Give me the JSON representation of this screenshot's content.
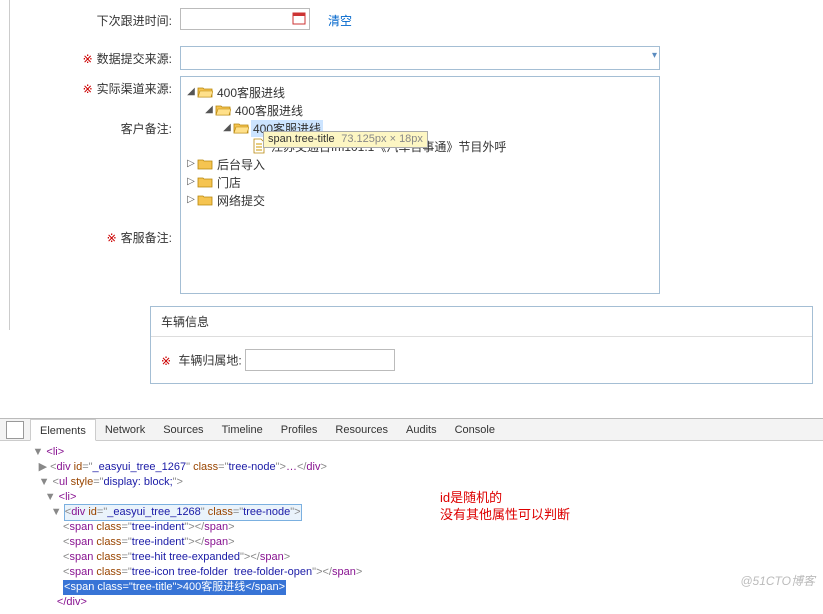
{
  "form": {
    "next_follow_label": "下次跟进时间:",
    "next_follow_value": "",
    "clear_link": "清空",
    "data_source_label": "数据提交来源:",
    "channel_label": "实际渠道来源:",
    "cust_remark_label": "客户备注:",
    "cs_remark_label": "客服备注:"
  },
  "tree": {
    "nodes": [
      {
        "label": "400客服进线",
        "level": 0,
        "expand": "open",
        "icon": "folder-open"
      },
      {
        "label": "400客服进线",
        "level": 1,
        "expand": "open",
        "icon": "folder-open"
      },
      {
        "label": "400客服进线",
        "level": 2,
        "expand": "open",
        "icon": "folder-open",
        "selected": true
      },
      {
        "label": "江苏交通台fm101.1《汽车百事通》节目外呼",
        "level": 3,
        "expand": "none",
        "icon": "file"
      },
      {
        "label": "后台导入",
        "level": 0,
        "expand": "closed",
        "icon": "folder-closed"
      },
      {
        "label": "门店",
        "level": 0,
        "expand": "closed",
        "icon": "folder-closed"
      },
      {
        "label": "网络提交",
        "level": 0,
        "expand": "closed",
        "icon": "folder-closed"
      }
    ]
  },
  "devtip": {
    "selector": "span.tree-title",
    "dims": "73.125px × 18px"
  },
  "section": {
    "title": "车辆信息",
    "vehicle_label": "车辆归属地:"
  },
  "devtools": {
    "tabs": [
      "Elements",
      "Network",
      "Sources",
      "Timeline",
      "Profiles",
      "Resources",
      "Audits",
      "Console"
    ],
    "active_tab": "Elements",
    "dom_lines": [
      {
        "indent": 4,
        "arrow": "▼",
        "html": "<li>"
      },
      {
        "indent": 5,
        "arrow": "▶",
        "html_parts": [
          "<div id=\"",
          "_easyui_tree_1267",
          "\" class=\"",
          "tree-node",
          "\">…</div>"
        ]
      },
      {
        "indent": 5,
        "arrow": "▼",
        "html_parts": [
          "<ul style=\"",
          "display: block;",
          "\">"
        ]
      },
      {
        "indent": 6,
        "arrow": "▼",
        "html": "<li>"
      },
      {
        "indent": 7,
        "arrow": "▼",
        "selected": true,
        "html_parts": [
          "<div id=\"",
          "_easyui_tree_1268",
          "\" class=\"",
          "tree-node",
          "\">"
        ]
      },
      {
        "indent": 8,
        "html_parts": [
          "<span class=\"",
          "tree-indent",
          "\"></span>"
        ]
      },
      {
        "indent": 8,
        "html_parts": [
          "<span class=\"",
          "tree-indent",
          "\"></span>"
        ]
      },
      {
        "indent": 8,
        "html_parts": [
          "<span class=\"",
          "tree-hit tree-expanded",
          "\"></span>"
        ]
      },
      {
        "indent": 8,
        "html_parts": [
          "<span class=\"",
          "tree-icon tree-folder  tree-folder-open",
          "\"></span>"
        ]
      },
      {
        "indent": 8,
        "highlight": true,
        "html_parts": [
          "<span class=\"",
          "tree-title",
          "\">",
          "400客服进线",
          "</span>"
        ]
      },
      {
        "indent": 7,
        "html": "</div>"
      }
    ],
    "annotation_line1": "id是随机的",
    "annotation_line2": "没有其他属性可以判断"
  },
  "watermark": "@51CTO博客"
}
